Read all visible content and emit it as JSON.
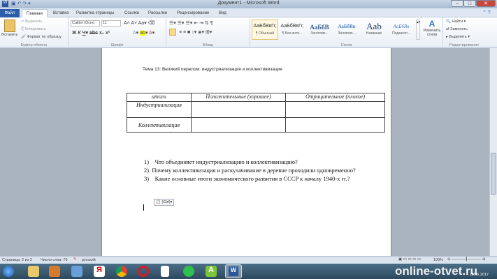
{
  "window": {
    "title": "Документ1 - Microsoft Word"
  },
  "tabs": [
    "Файл",
    "Главная",
    "Вставка",
    "Разметка страницы",
    "Ссылки",
    "Рассылки",
    "Рецензирование",
    "Вид"
  ],
  "clipboard": {
    "paste": "Вставить",
    "cut": "Вырезать",
    "copy": "Копировать",
    "format_painter": "Формат по образцу",
    "label": "Буфер обмена"
  },
  "font": {
    "name": "Calibri (Осно",
    "size": "11",
    "label": "Шрифт"
  },
  "paragraph": {
    "label": "Абзац"
  },
  "styles": {
    "items": [
      {
        "preview": "АаБбВвГг,",
        "name": "¶ Обычный"
      },
      {
        "preview": "АаБбВвГг,",
        "name": "¶ Без инте..."
      },
      {
        "preview": "АаБбВ",
        "name": "Заголово..."
      },
      {
        "preview": "АаБбВв",
        "name": "Заголово..."
      },
      {
        "preview": "Aab",
        "name": "Название"
      },
      {
        "preview": "АаБбВв",
        "name": "Подзагол..."
      }
    ],
    "change": "Изменить стили",
    "label": "Стили"
  },
  "editing": {
    "find": "Найти",
    "replace": "Заменить",
    "select": "Выделить",
    "label": "Редактирование"
  },
  "document": {
    "heading": "Тема 13: Великий перелом: индустриализация и коллективизация",
    "table": {
      "headers": [
        "итоги",
        "Положительные (хорошее)",
        "Отрицательное (плохое)"
      ],
      "rows": [
        [
          "Индустриализация",
          "",
          ""
        ],
        [
          "Коллективизация",
          "",
          ""
        ]
      ]
    },
    "questions": [
      {
        "num": "1)",
        "text": "Что объединяет индустриализацию и коллективизацию?"
      },
      {
        "num": "2)",
        "text": "Почему коллективизация и раскулачивание в деревне проходили одновременно?"
      },
      {
        "num": "3)",
        "text": "Какие основные итоги экономического развития в СССР к началу 1940-х гг.?"
      }
    ],
    "paste_options": "(Ctrl)"
  },
  "status": {
    "page": "Страница: 2 из 2",
    "words": "Число слов: 76",
    "language": "русский",
    "zoom": "100%"
  },
  "taskbar": {
    "date": "11.06.2017"
  },
  "watermark": "online-otvet.ru"
}
